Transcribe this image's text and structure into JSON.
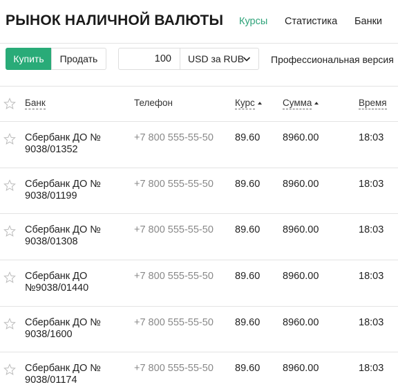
{
  "header": {
    "title": "РЫНОК НАЛИЧНОЙ ВАЛЮТЫ",
    "nav": [
      {
        "label": "Курсы",
        "active": true
      },
      {
        "label": "Статистика",
        "active": false
      },
      {
        "label": "Банки",
        "active": false
      }
    ]
  },
  "toolbar": {
    "buy_label": "Купить",
    "sell_label": "Продать",
    "amount_value": "100",
    "currency_label": "USD за RUB",
    "pro_label": "Профессиональная версия"
  },
  "table": {
    "columns": {
      "bank": "Банк",
      "phone": "Телефон",
      "rate": "Курс",
      "sum": "Сумма",
      "time": "Время"
    },
    "rows": [
      {
        "bank": "Сбербанк ДО № 9038/01352",
        "phone": "+7 800 555-55-50",
        "rate": "89.60",
        "sum": "8960.00",
        "time": "18:03"
      },
      {
        "bank": "Сбербанк ДО № 9038/01199",
        "phone": "+7 800 555-55-50",
        "rate": "89.60",
        "sum": "8960.00",
        "time": "18:03"
      },
      {
        "bank": "Сбербанк ДО № 9038/01308",
        "phone": "+7 800 555-55-50",
        "rate": "89.60",
        "sum": "8960.00",
        "time": "18:03"
      },
      {
        "bank": "Сбербанк ДО №9038/01440",
        "phone": "+7 800 555-55-50",
        "rate": "89.60",
        "sum": "8960.00",
        "time": "18:03"
      },
      {
        "bank": "Сбербанк ДО № 9038/1600",
        "phone": "+7 800 555-55-50",
        "rate": "89.60",
        "sum": "8960.00",
        "time": "18:03"
      },
      {
        "bank": "Сбербанк ДО № 9038/01174",
        "phone": "+7 800 555-55-50",
        "rate": "89.60",
        "sum": "8960.00",
        "time": "18:03"
      }
    ]
  },
  "colors": {
    "accent": "#29ab78",
    "nav_active": "#2fa37a",
    "muted": "#888888"
  },
  "icons": {
    "favorite": "star-outline-icon",
    "dropdown": "chevron-down-icon",
    "sort": "sort-up-icon"
  }
}
